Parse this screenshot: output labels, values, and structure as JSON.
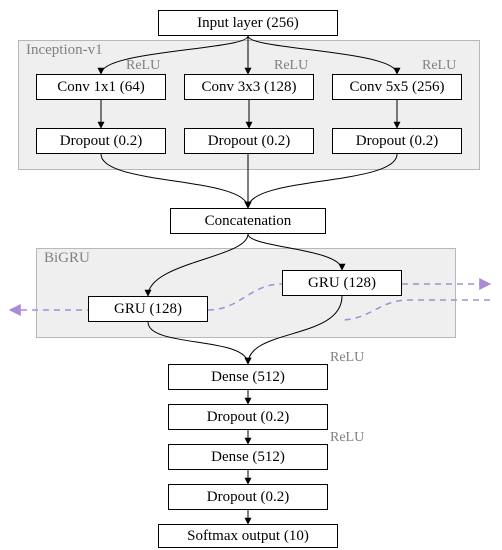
{
  "labels": {
    "input": "Input layer (256)",
    "conv1": "Conv 1x1 (64)",
    "conv3": "Conv 3x3 (128)",
    "conv5": "Conv 5x5 (256)",
    "dropout": "Dropout (0.2)",
    "concat": "Concatenation",
    "gru": "GRU (128)",
    "dense": "Dense (512)",
    "softmax": "Softmax output (10)"
  },
  "groups": {
    "inception": "Inception-v1",
    "bigru": "BiGRU"
  },
  "activation": "ReLU",
  "chart_data": {
    "type": "diagram",
    "architecture": "Neural network architecture (Inception-v1 branches + BiGRU + dense classifier)",
    "nodes": [
      {
        "id": "input",
        "label": "Input layer",
        "units": 256
      },
      {
        "id": "inception",
        "label": "Inception-v1",
        "type": "group",
        "children": [
          {
            "id": "conv1",
            "label": "Conv 1x1",
            "filters": 64,
            "activation": "ReLU"
          },
          {
            "id": "conv3",
            "label": "Conv 3x3",
            "filters": 128,
            "activation": "ReLU"
          },
          {
            "id": "conv5",
            "label": "Conv 5x5",
            "filters": 256,
            "activation": "ReLU"
          },
          {
            "id": "drop_a",
            "label": "Dropout",
            "rate": 0.2,
            "after": "conv1"
          },
          {
            "id": "drop_b",
            "label": "Dropout",
            "rate": 0.2,
            "after": "conv3"
          },
          {
            "id": "drop_c",
            "label": "Dropout",
            "rate": 0.2,
            "after": "conv5"
          }
        ]
      },
      {
        "id": "concat",
        "label": "Concatenation"
      },
      {
        "id": "bigru",
        "label": "BiGRU",
        "type": "group",
        "children": [
          {
            "id": "gru_fwd",
            "label": "GRU",
            "units": 128,
            "direction": "forward"
          },
          {
            "id": "gru_bwd",
            "label": "GRU",
            "units": 128,
            "direction": "backward"
          }
        ]
      },
      {
        "id": "dense1",
        "label": "Dense",
        "units": 512,
        "activation": "ReLU"
      },
      {
        "id": "drop1",
        "label": "Dropout",
        "rate": 0.2
      },
      {
        "id": "dense2",
        "label": "Dense",
        "units": 512,
        "activation": "ReLU"
      },
      {
        "id": "drop2",
        "label": "Dropout",
        "rate": 0.2
      },
      {
        "id": "softmax",
        "label": "Softmax output",
        "units": 10
      }
    ],
    "edges": [
      [
        "input",
        "conv1"
      ],
      [
        "input",
        "conv3"
      ],
      [
        "input",
        "conv5"
      ],
      [
        "conv1",
        "drop_a"
      ],
      [
        "conv3",
        "drop_b"
      ],
      [
        "conv5",
        "drop_c"
      ],
      [
        "drop_a",
        "concat"
      ],
      [
        "drop_b",
        "concat"
      ],
      [
        "drop_c",
        "concat"
      ],
      [
        "concat",
        "gru_fwd"
      ],
      [
        "concat",
        "gru_bwd"
      ],
      [
        "gru_fwd",
        "dense1"
      ],
      [
        "gru_bwd",
        "dense1"
      ],
      [
        "dense1",
        "drop1"
      ],
      [
        "drop1",
        "dense2"
      ],
      [
        "dense2",
        "drop2"
      ],
      [
        "drop2",
        "softmax"
      ]
    ]
  }
}
